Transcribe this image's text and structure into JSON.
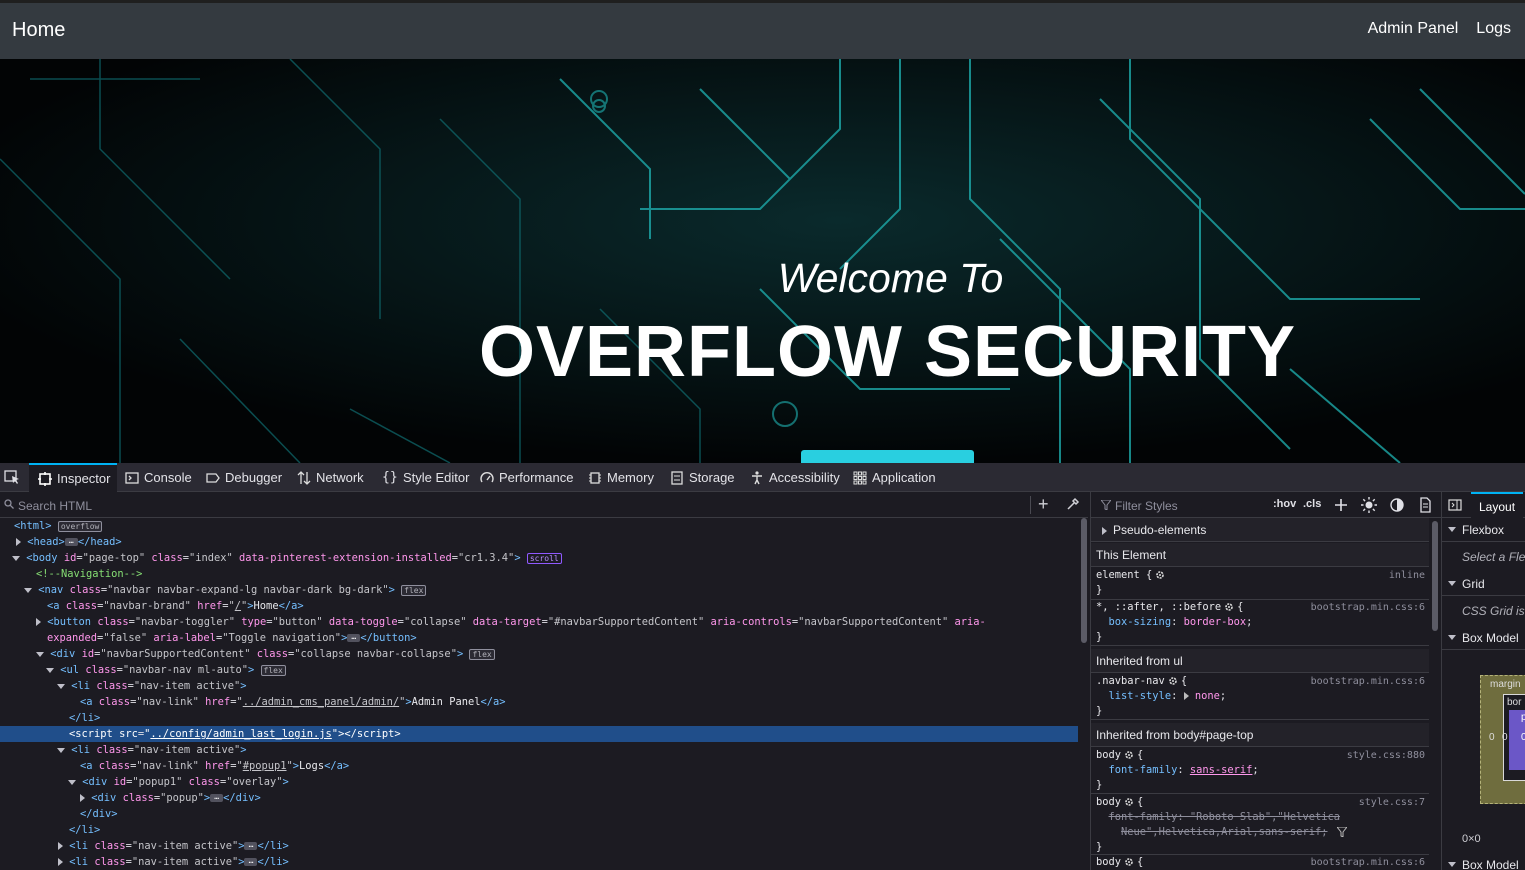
{
  "navbar": {
    "brand": "Home",
    "links": [
      "Admin Panel",
      "Logs"
    ]
  },
  "hero": {
    "subtitle": "Welcome To",
    "title": "OVERFLOW SECURITY"
  },
  "devtools": {
    "tabs": [
      "Inspector",
      "Console",
      "Debugger",
      "Network",
      "Style Editor",
      "Performance",
      "Memory",
      "Storage",
      "Accessibility",
      "Application"
    ],
    "active_tab": "Inspector",
    "search_placeholder": "Search HTML",
    "filter_placeholder": "Filter Styles",
    "hov_label": ":hov",
    "cls_label": ".cls",
    "rules": {
      "pseudo": "Pseudo-elements",
      "this_element": "This Element",
      "inherited_ul": "Inherited from ul",
      "inherited_body": "Inherited from body#page-top"
    },
    "layout": {
      "tab": "Layout",
      "flexbox": "Flexbox",
      "flex_note": "Select a Flex",
      "grid": "Grid",
      "grid_note": "CSS Grid is n",
      "box_model": "Box Model",
      "box_margin": "margin",
      "box_border": "bor",
      "box_padding": "p",
      "box_zero_left": "0",
      "box_zero_inner": "0",
      "box_zero_right": "0",
      "dims": "0×0",
      "box_model_props": "Box Model P"
    }
  },
  "colors": {
    "navbar_bg": "#343a40",
    "accent": "#29cfe0",
    "selection": "#204e8a",
    "devtools_bg": "#1c1b22",
    "tab_indicator": "#00b3f4"
  }
}
